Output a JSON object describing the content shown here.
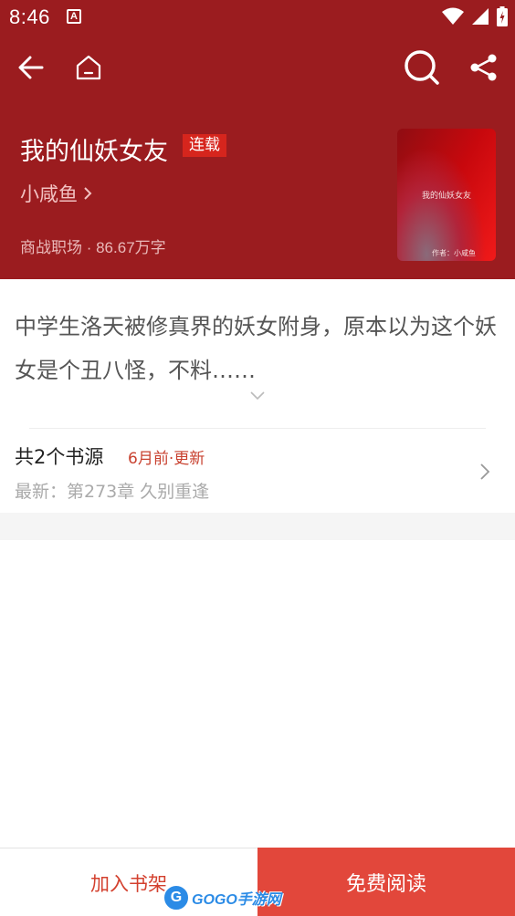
{
  "status_bar": {
    "time": "8:46",
    "notification_icon": "A"
  },
  "toolbar": {
    "back_icon": "arrow-left-icon",
    "home_icon": "home-icon",
    "search_icon": "search-icon",
    "share_icon": "share-icon"
  },
  "book": {
    "title": "我的仙妖女友",
    "status_badge": "连载",
    "author": "小咸鱼",
    "meta": "商战职场 · 86.67万字",
    "cover_title": "我的仙妖女友",
    "cover_author": "作者：小咸鱼"
  },
  "intro": {
    "text": "中学生洛天被修真界的妖女附身，原本以为这个妖女是个丑八怪，不料……"
  },
  "sources": {
    "count_label": "共2个书源",
    "update_label": "6月前·更新",
    "latest_label": "最新：第273章 久别重逢"
  },
  "bottom_bar": {
    "add_shelf_label": "加入书架",
    "read_free_label": "免费阅读"
  },
  "watermark": {
    "logo": "G",
    "text": "GOGO手游网"
  },
  "colors": {
    "header_bg": "#9b1c1f",
    "badge_bg": "#d6251d",
    "accent": "#e2473b",
    "update_text": "#c8412f"
  }
}
